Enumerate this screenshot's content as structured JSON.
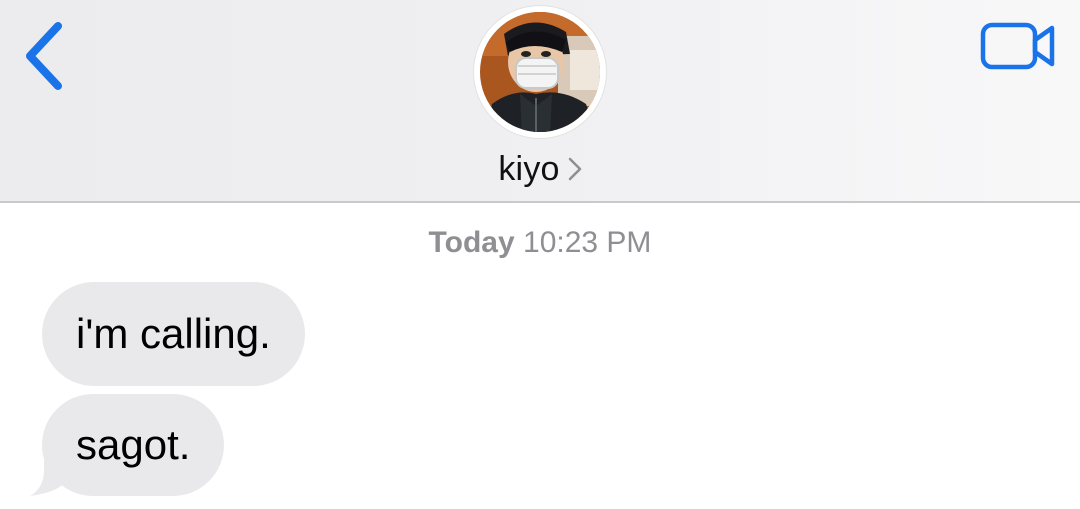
{
  "header": {
    "contact_name": "kiyo",
    "back_icon": "chevron-left-icon",
    "video_icon": "video-camera-icon",
    "chevron_icon": "chevron-right-icon",
    "accent_color": "#1a73e8"
  },
  "conversation": {
    "timestamp_day": "Today",
    "timestamp_time": "10:23 PM",
    "messages": [
      {
        "text": "i'm calling.",
        "direction": "incoming"
      },
      {
        "text": "sagot.",
        "direction": "incoming"
      }
    ],
    "incoming_bubble_color": "#e9e9eb"
  }
}
